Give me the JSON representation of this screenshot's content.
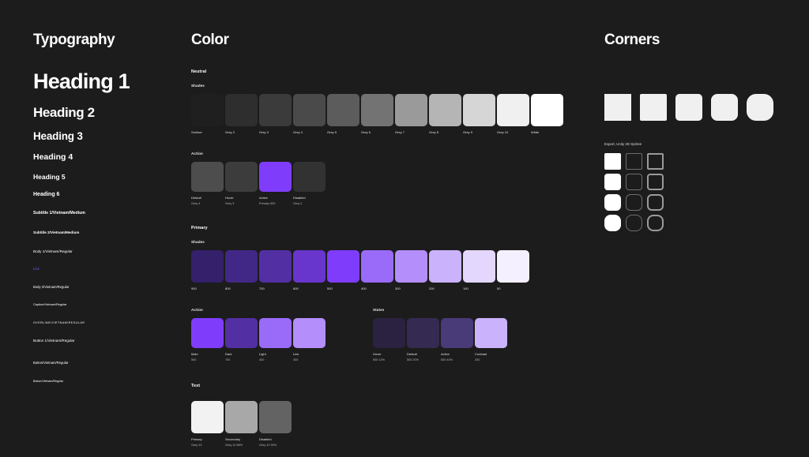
{
  "sections": {
    "typography_title": "Typography",
    "color_title": "Color",
    "corners_title": "Corners"
  },
  "typography": {
    "items": [
      {
        "label": "Heading 1",
        "style": "t-h1"
      },
      {
        "label": "Heading 2",
        "style": "t-h2"
      },
      {
        "label": "Heading 3",
        "style": "t-h3"
      },
      {
        "label": "Heading 4",
        "style": "t-h4"
      },
      {
        "label": "Heading 5",
        "style": "t-h5"
      },
      {
        "label": "Heading 6",
        "style": "t-h6"
      },
      {
        "label": "Subtitle 1/Vietnam/Medium",
        "style": "t-sub1"
      },
      {
        "label": "Subtitle 2/Vietnam/Medium",
        "style": "t-sub2"
      },
      {
        "label": "Body 1/Vietnam/Regular",
        "style": "t-body1"
      },
      {
        "label": "Link",
        "style": "t-link"
      },
      {
        "label": "Body 2/Vietnam/Regular",
        "style": "t-body2"
      },
      {
        "label": "Caption/Vietnam/Regular",
        "style": "t-caption"
      },
      {
        "label": "OVERLINE/VIETNAM/REGULAR",
        "style": "t-overline"
      },
      {
        "label": "Button 1/Vietnam/Regular",
        "style": "t-btn1"
      },
      {
        "label": "Button/Vietnam/Regular",
        "style": "t-btn2"
      },
      {
        "label": "Button/Vietnam/Regular",
        "style": "t-btn3"
      }
    ],
    "link_color": "#7c4dff"
  },
  "color": {
    "neutral": {
      "group": "Neutral",
      "shades_label": "Shades",
      "shades": [
        {
          "name": "Surface",
          "value": "",
          "hex": "#1f1f1f"
        },
        {
          "name": "Grey 2",
          "value": "",
          "hex": "#2e2e2e"
        },
        {
          "name": "Grey 3",
          "value": "",
          "hex": "#3b3b3b"
        },
        {
          "name": "Grey 4",
          "value": "",
          "hex": "#4a4a4a"
        },
        {
          "name": "Grey 5",
          "value": "",
          "hex": "#5c5c5c"
        },
        {
          "name": "Grey 6",
          "value": "",
          "hex": "#737373"
        },
        {
          "name": "Grey 7",
          "value": "",
          "hex": "#9a9a9a"
        },
        {
          "name": "Grey 8",
          "value": "",
          "hex": "#b5b5b5"
        },
        {
          "name": "Grey 9",
          "value": "",
          "hex": "#d6d6d6"
        },
        {
          "name": "Grey 10",
          "value": "",
          "hex": "#f0f0f0"
        },
        {
          "name": "White",
          "value": "",
          "hex": "#ffffff"
        }
      ],
      "action_label": "Action",
      "action": [
        {
          "name": "Default",
          "value": "Grey 4",
          "hex": "#4d4d4d"
        },
        {
          "name": "Hover",
          "value": "Grey 3",
          "hex": "#3c3c3c"
        },
        {
          "name": "Active",
          "value": "Primary 500",
          "hex": "#7f3dfb"
        },
        {
          "name": "Disabled",
          "value": "Grey 2",
          "hex": "#323232"
        }
      ]
    },
    "primary": {
      "group": "Primary",
      "shades_label": "Shades",
      "shades": [
        {
          "name": "900",
          "value": "",
          "hex": "#34206b"
        },
        {
          "name": "800",
          "value": "",
          "hex": "#422886"
        },
        {
          "name": "700",
          "value": "",
          "hex": "#532fa4"
        },
        {
          "name": "600",
          "value": "",
          "hex": "#6836cc"
        },
        {
          "name": "500",
          "value": "",
          "hex": "#7f3dfb"
        },
        {
          "name": "400",
          "value": "",
          "hex": "#9a6bf9"
        },
        {
          "name": "300",
          "value": "",
          "hex": "#b48ffb"
        },
        {
          "name": "200",
          "value": "",
          "hex": "#cbb2fc"
        },
        {
          "name": "100",
          "value": "",
          "hex": "#e4d7fd"
        },
        {
          "name": "50",
          "value": "",
          "hex": "#f5f0ff"
        }
      ],
      "action_label": "Action",
      "action": [
        {
          "name": "Main",
          "value": "500",
          "hex": "#7f3dfb"
        },
        {
          "name": "Dark",
          "value": "700",
          "hex": "#532fa4"
        },
        {
          "name": "Light",
          "value": "400",
          "hex": "#9a6bf9"
        },
        {
          "name": "Link",
          "value": "300",
          "hex": "#b48ffb"
        }
      ],
      "states_label": "States",
      "states": [
        {
          "name": "Hover",
          "value": "500 12%",
          "hex": "#2b2242"
        },
        {
          "name": "Default",
          "value": "500 20%",
          "hex": "#342a52"
        },
        {
          "name": "Active",
          "value": "500 40%",
          "hex": "#493a78"
        },
        {
          "name": "Contrast",
          "value": "200",
          "hex": "#cbb2fc"
        }
      ]
    },
    "text": {
      "group": "Text",
      "items": [
        {
          "name": "Primary",
          "value": "Grey 10",
          "hex": "#f2f2f2"
        },
        {
          "name": "Secondary",
          "value": "Grey 10 66%",
          "hex": "#a8a8a8"
        },
        {
          "name": "Disabled",
          "value": "Grey 10 30%",
          "hex": "#636363"
        }
      ]
    }
  },
  "corners": {
    "boxes": [
      {
        "radius": "0px"
      },
      {
        "radius": "2px"
      },
      {
        "radius": "5px"
      },
      {
        "radius": "8px"
      },
      {
        "radius": "12px"
      }
    ],
    "export_label": "Export, Unity 2D Sprites",
    "sprite_rows": [
      {
        "radius": "2px"
      },
      {
        "radius": "4px"
      },
      {
        "radius": "6px"
      },
      {
        "radius": "8px"
      }
    ]
  }
}
